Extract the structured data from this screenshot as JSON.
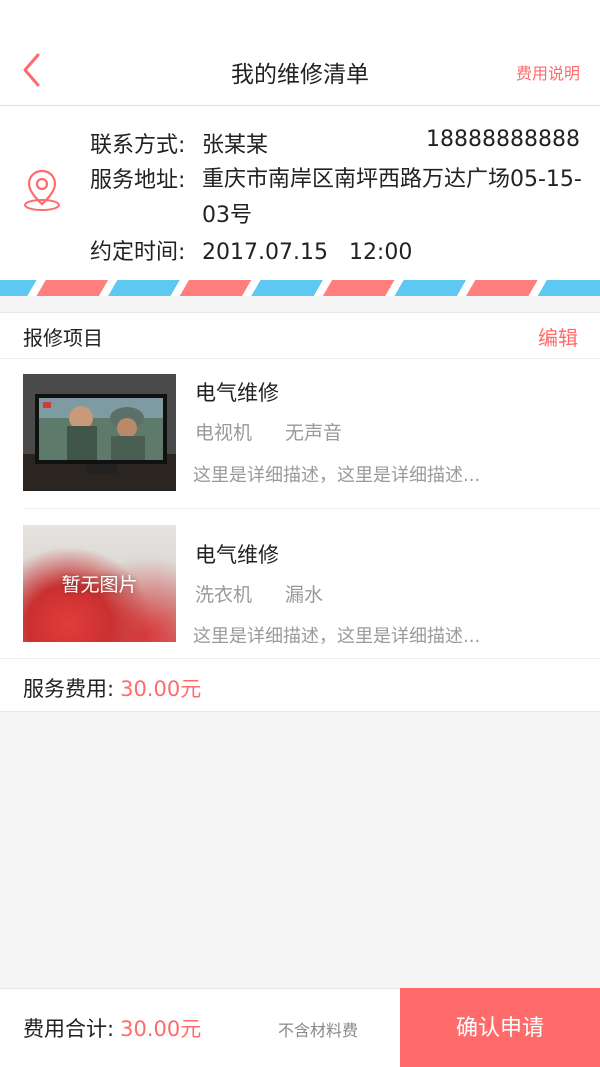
{
  "header": {
    "title": "我的维修清单",
    "fee_link": "费用说明"
  },
  "contact": {
    "label": "联系方式:",
    "name": "张某某",
    "phone": "18888888888",
    "address_label": "服务地址:",
    "address": "重庆市南岸区南坪西路万达广场05-15-03号",
    "time_label": "约定时间:",
    "time": "2017.07.15   12:00"
  },
  "repair": {
    "section_title": "报修项目",
    "edit_label": "编辑",
    "items": [
      {
        "title": "电气维修",
        "device": "电视机",
        "issue": "无声音",
        "desc": "这里是详细描述，这里是详细描述...",
        "image": "tv-photo"
      },
      {
        "title": "电气维修",
        "device": "洗衣机",
        "issue": "漏水",
        "desc": "这里是详细描述，这里是详细描述...",
        "image_placeholder": "暂无图片"
      }
    ],
    "service_fee_label": "服务费用:",
    "service_fee": "30.00元"
  },
  "footer": {
    "total_label": "费用合计:",
    "total": "30.00元",
    "note": "不含材料费",
    "confirm_label": "确认申请"
  },
  "colors": {
    "accent": "#ff6b6b",
    "stripe_blue": "#5ec8f2",
    "stripe_red": "#ff7f7f"
  }
}
